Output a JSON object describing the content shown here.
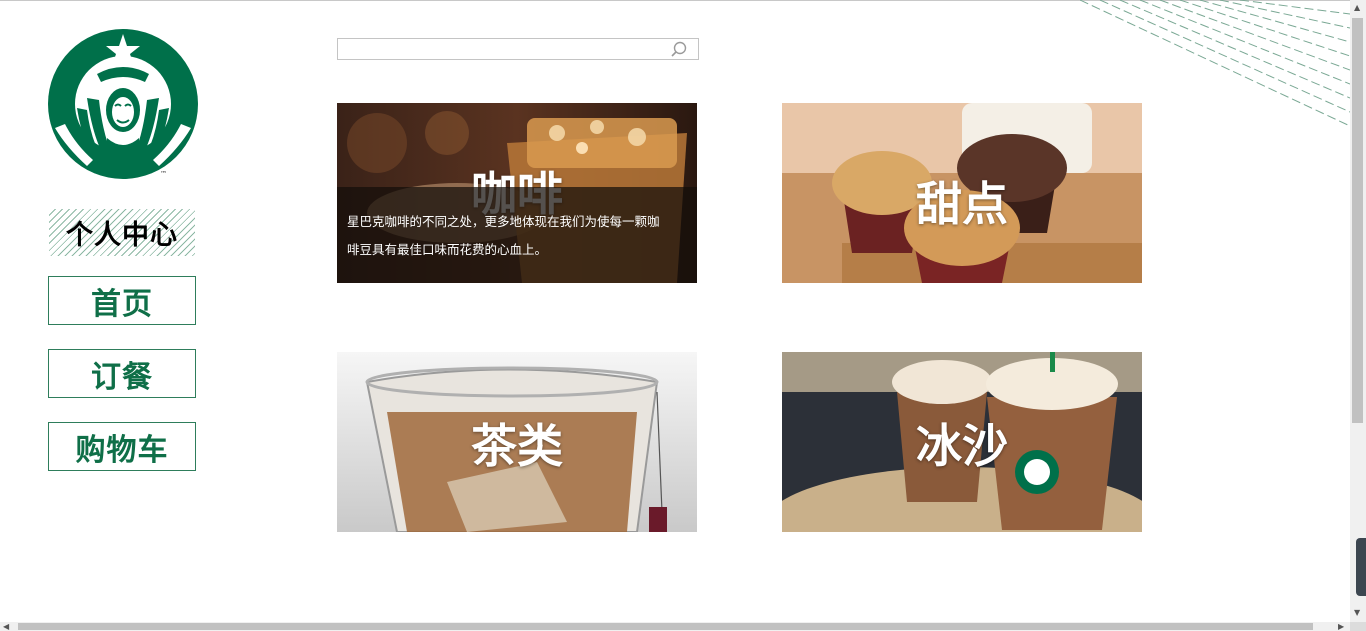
{
  "brand": {
    "trademark": "™"
  },
  "nav": {
    "items": [
      {
        "label": "个人中心",
        "active": true
      },
      {
        "label": "首页",
        "active": false
      },
      {
        "label": "订餐",
        "active": false
      },
      {
        "label": "购物车",
        "active": false
      }
    ]
  },
  "search": {
    "value": "",
    "placeholder": ""
  },
  "categories": [
    {
      "title": "咖啡",
      "description_line1": "星巴克咖啡的不同之处，更多地体现在我们为使每一颗咖",
      "description_line2": "啡豆具有最佳口味而花费的心血上。"
    },
    {
      "title": "甜点"
    },
    {
      "title": "茶类"
    },
    {
      "title": "冰沙"
    }
  ],
  "colors": {
    "brand_green": "#00704a",
    "nav_text": "#0f6f48",
    "nav_border": "#2e7d5b"
  }
}
